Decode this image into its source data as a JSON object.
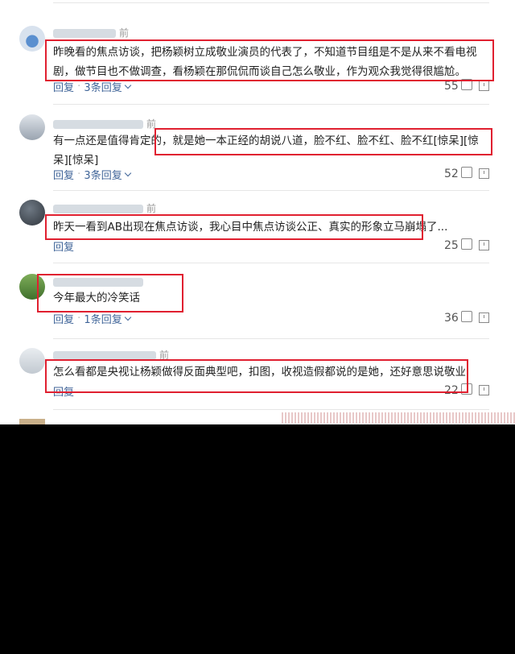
{
  "comments": [
    {
      "meta_suffix": "前",
      "text": "昨晚看的焦点访谈，把杨颖树立成敬业演员的代表了，不知道节目组是不是从来不看电视剧，做节目也不做调查，看杨颖在那侃侃而谈自己怎么敬业，作为观众我觉得很尴尬。",
      "reply_label": "回复",
      "reply_count": "3条回复",
      "likes": "55"
    },
    {
      "meta_suffix": "前",
      "text": "有一点还是值得肯定的，就是她一本正经的胡说八道，脸不红、脸不红、脸不红[惊呆][惊呆][惊呆]",
      "reply_label": "回复",
      "reply_count": "3条回复",
      "likes": "52"
    },
    {
      "meta_suffix": "前",
      "text": "昨天一看到AB出现在焦点访谈，我心目中焦点访谈公正、真实的形象立马崩塌了...",
      "reply_label": "回复",
      "reply_count": "",
      "likes": "25"
    },
    {
      "meta_suffix": "",
      "text": "今年最大的冷笑话",
      "reply_label": "回复",
      "reply_count": "1条回复",
      "likes": "36"
    },
    {
      "meta_suffix": "前",
      "text": "怎么看都是央视让杨颖做得反面典型吧，扣图，收视造假都说的是她，还好意思说敬业",
      "reply_label": "回复",
      "reply_count": "",
      "likes": "22"
    }
  ],
  "colors": {
    "highlight_box": "#e02030",
    "link": "#406599",
    "background_below": "#000000"
  },
  "icons": {
    "like": "thumbs-up-icon",
    "report": "report-icon",
    "expand": "chevron-down-icon"
  }
}
